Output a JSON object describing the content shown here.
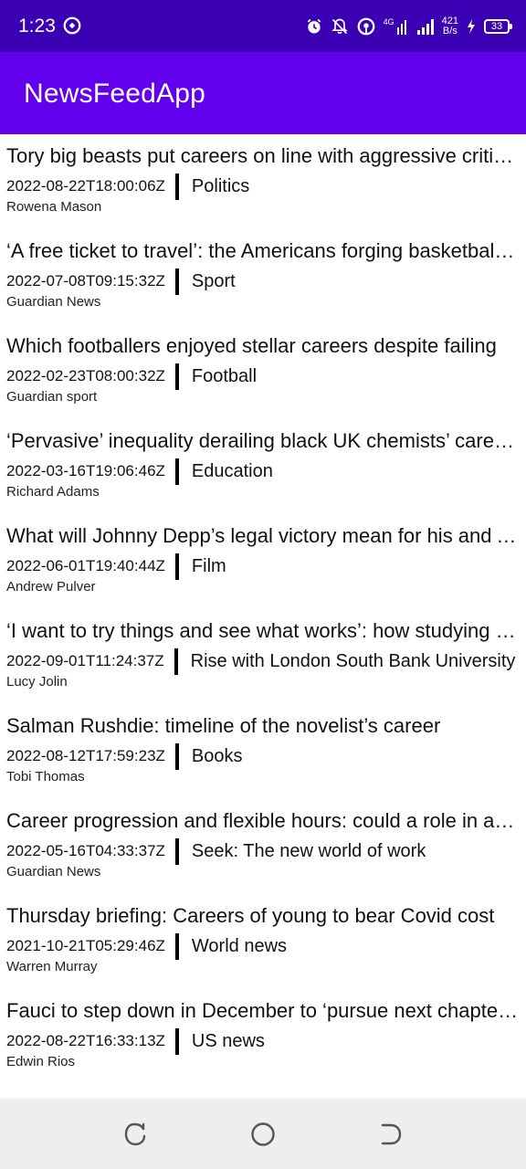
{
  "status_bar": {
    "time": "1:23",
    "net_speed_value": "421",
    "net_speed_unit": "B/s",
    "network_type": "4G",
    "battery_level": "33"
  },
  "app_bar": {
    "title": "NewsFeedApp"
  },
  "feed": {
    "items": [
      {
        "title": "Tory big beasts put careers on line with aggressive criticism",
        "date": "2022-08-22T18:00:06Z",
        "section": "Politics",
        "author": "Rowena Mason"
      },
      {
        "title": "‘A free ticket to travel’: the Americans forging basketball careers",
        "date": "2022-07-08T09:15:32Z",
        "section": "Sport",
        "author": "Guardian News"
      },
      {
        "title": "Which footballers enjoyed stellar careers despite failing",
        "date": "2022-02-23T08:00:32Z",
        "section": "Football",
        "author": "Guardian sport"
      },
      {
        "title": "‘Pervasive’ inequality derailing black UK chemists’ careers",
        "date": "2022-03-16T19:06:46Z",
        "section": "Education",
        "author": "Richard Adams"
      },
      {
        "title": "What will Johnny Depp’s legal victory mean for his and Amber Heard’s careers?",
        "date": "2022-06-01T19:40:44Z",
        "section": "Film",
        "author": "Andrew Pulver"
      },
      {
        "title": "‘I want to try things and see what works’: how studying could help your career",
        "date": "2022-09-01T11:24:37Z",
        "section": "Rise with London South Bank University",
        "author": "Lucy Jolin"
      },
      {
        "title": "Salman Rushdie: timeline of the novelist’s career",
        "date": "2022-08-12T17:59:23Z",
        "section": "Books",
        "author": "Tobi Thomas"
      },
      {
        "title": "Career progression and flexible hours: could a role in aged care suit you?",
        "date": "2022-05-16T04:33:37Z",
        "section": "Seek: The new world of work",
        "author": "Guardian News"
      },
      {
        "title": "Thursday briefing: Careers of young to bear Covid cost",
        "date": "2021-10-21T05:29:46Z",
        "section": "World news",
        "author": "Warren Murray"
      },
      {
        "title": "Fauci to step down in December to ‘pursue next chapter’ of career",
        "date": "2022-08-22T16:33:13Z",
        "section": "US news",
        "author": "Edwin Rios"
      }
    ]
  },
  "nav_bar": {
    "buttons": [
      "recent-apps-icon",
      "home-icon",
      "back-icon"
    ]
  },
  "colors": {
    "status_bar": "#3b00b3",
    "app_bar": "#6200ee",
    "nav_bar": "#eeeeee"
  }
}
